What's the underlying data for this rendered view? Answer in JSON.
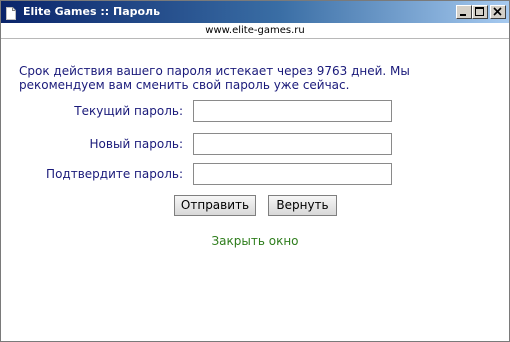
{
  "window": {
    "title": "Elite Games :: Пароль",
    "url": "www.elite-games.ru"
  },
  "notice": "Срок действия вашего пароля истекает через 9763 дней. Мы рекомендуем вам сменить свой пароль уже сейчас.",
  "form": {
    "current_password_label": "Текущий пароль:",
    "new_password_label": "Новый пароль:",
    "confirm_password_label": "Подтвердите пароль:",
    "current_password_value": "",
    "new_password_value": "",
    "confirm_password_value": "",
    "submit_label": "Отправить",
    "reset_label": "Вернуть"
  },
  "close_link": "Закрыть окно",
  "colors": {
    "titlebar_start": "#0a246a",
    "titlebar_end": "#a6caf0",
    "text": "#1a1a7a",
    "link": "#2e7d1c"
  },
  "icons": {
    "app": "document-icon",
    "minimize": "minimize-icon",
    "maximize": "maximize-icon",
    "close": "close-icon"
  }
}
